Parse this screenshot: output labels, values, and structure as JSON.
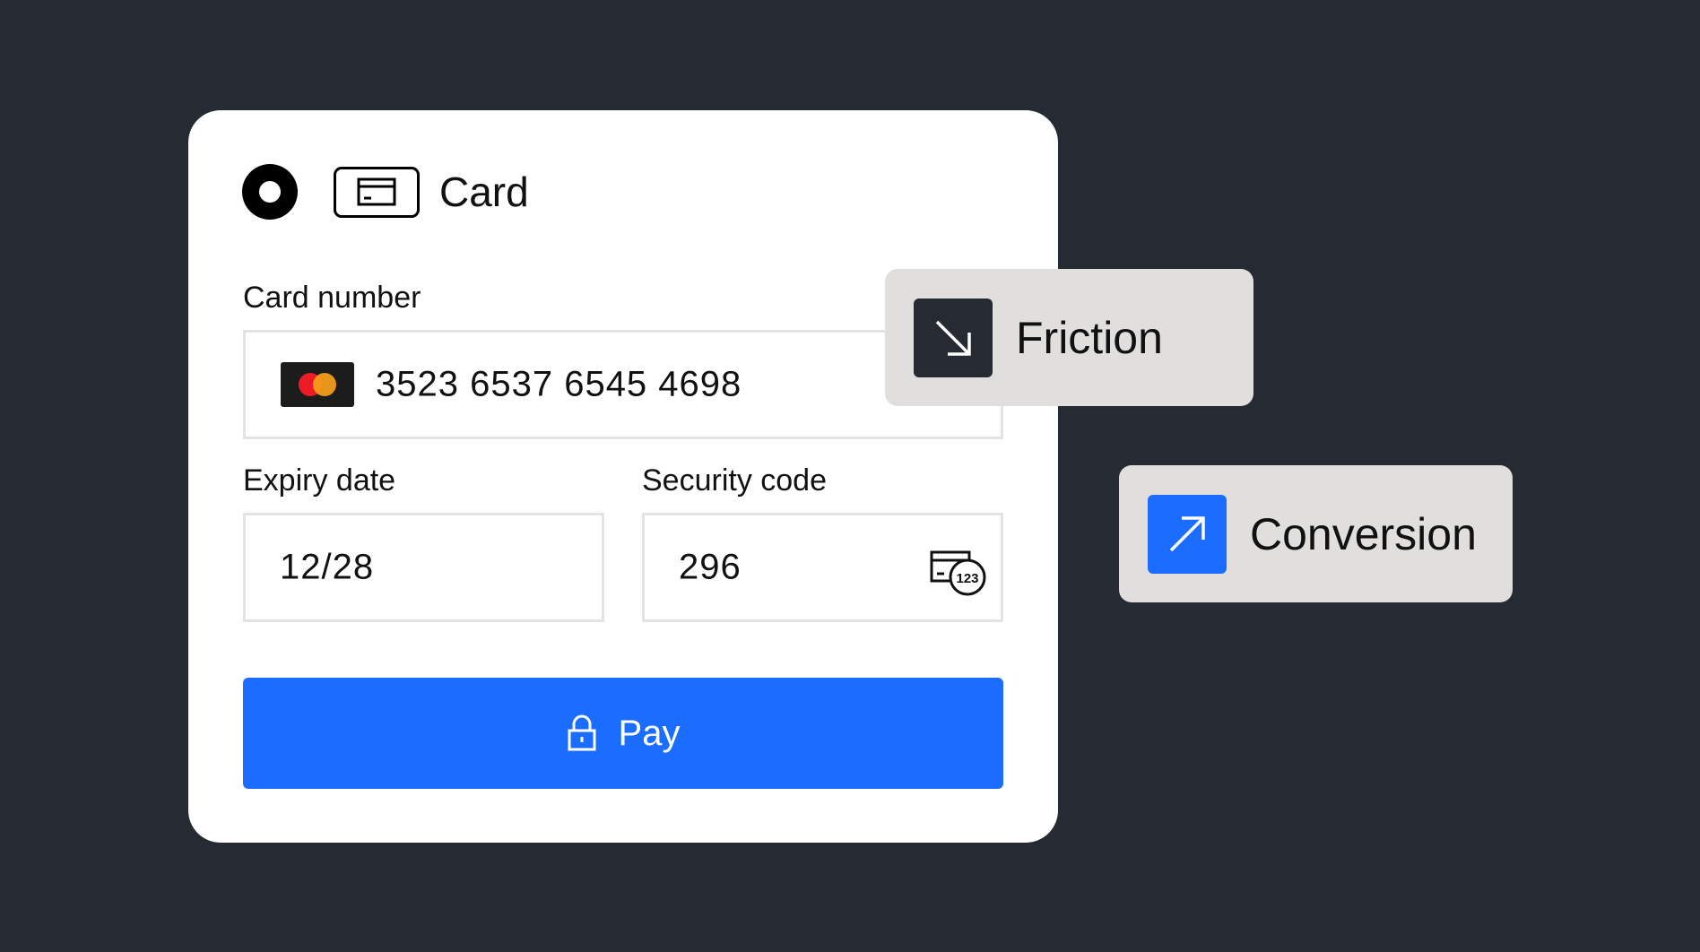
{
  "payment_method": {
    "label": "Card",
    "icon": "credit-card-icon",
    "selected": true
  },
  "card_number": {
    "label": "Card number",
    "value": "3523 6537 6545 4698",
    "brand_icon": "mastercard-logo-icon"
  },
  "expiry": {
    "label": "Expiry date",
    "value": "12/28"
  },
  "security_code": {
    "label": "Security code",
    "value": "296",
    "icon": "cvc-card-icon"
  },
  "pay_button": {
    "label": "Pay",
    "icon": "lock-icon"
  },
  "tags": {
    "friction": {
      "label": "Friction",
      "icon": "arrow-down-right-icon"
    },
    "conversion": {
      "label": "Conversion",
      "icon": "arrow-up-right-icon"
    }
  },
  "colors": {
    "background": "#262a33",
    "accent": "#1a6dff",
    "tag_background": "#e0dfdd",
    "friction_icon": "#262a33"
  }
}
